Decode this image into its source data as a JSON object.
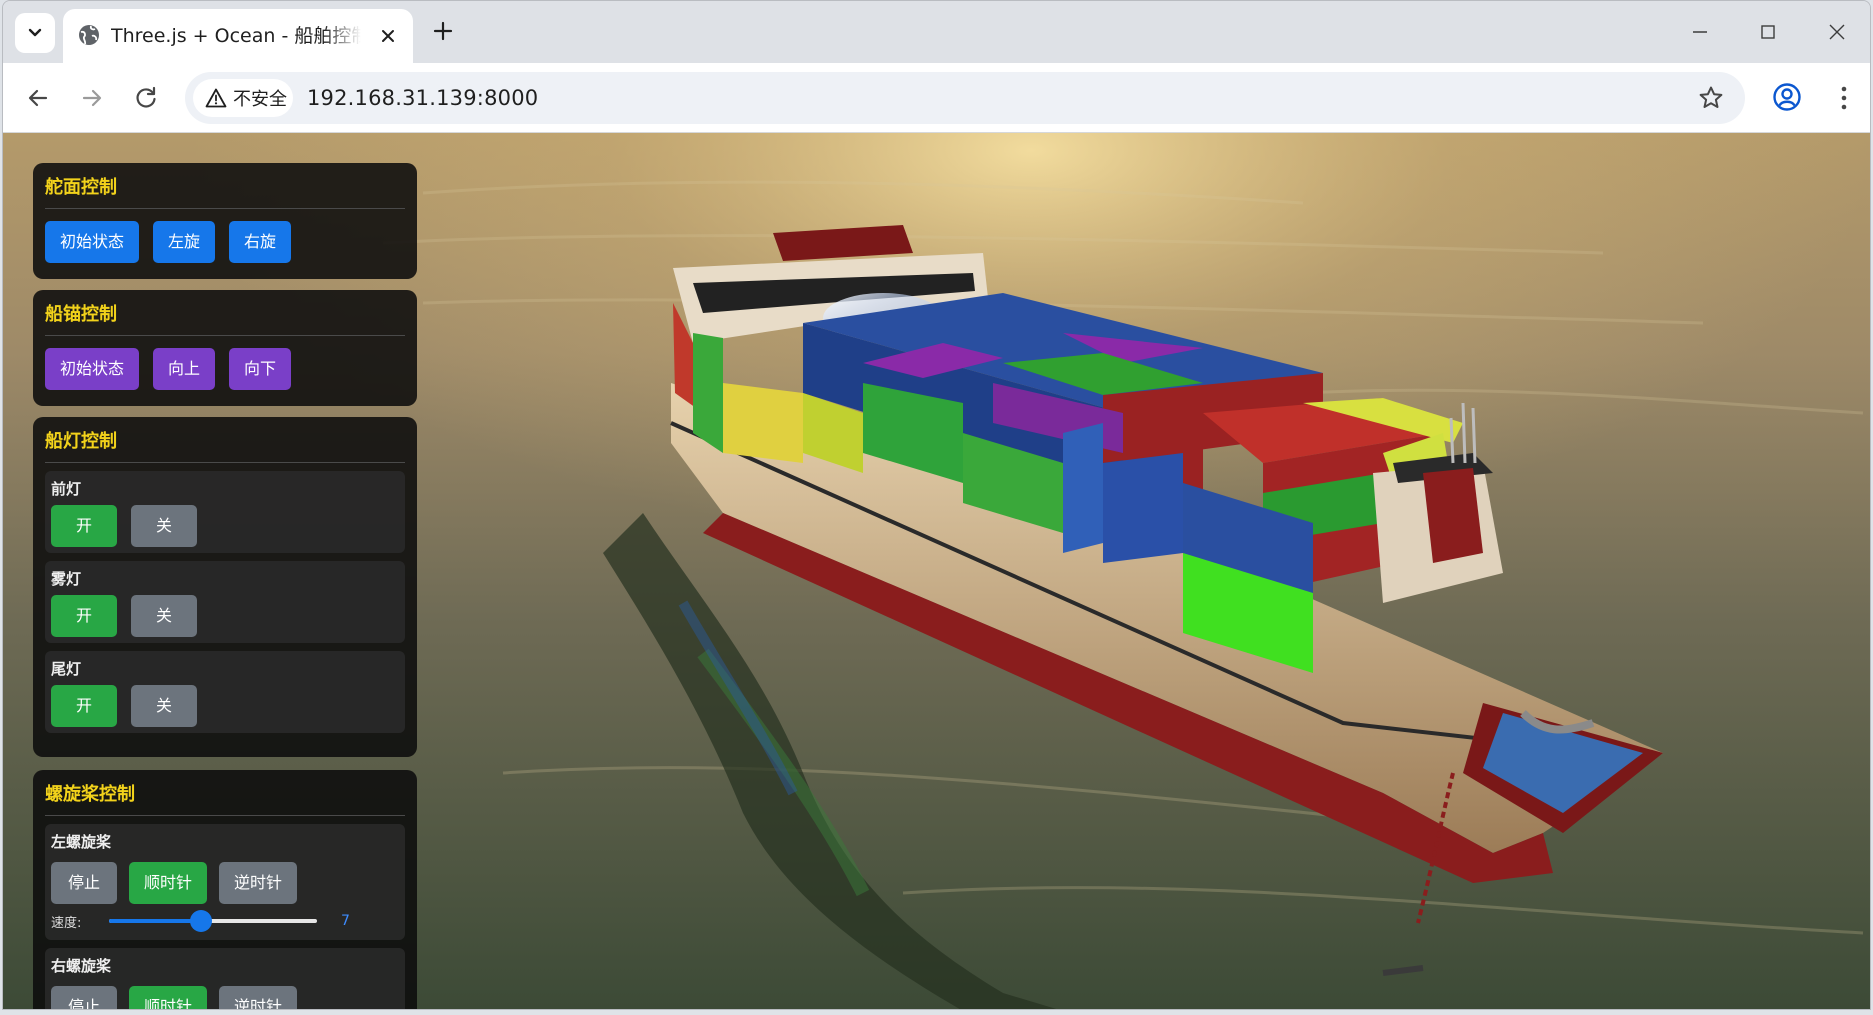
{
  "browser": {
    "tab_title": "Three.js + Ocean - 船舶控制台",
    "security_label": "不安全",
    "url": "192.168.31.139:8000"
  },
  "icons": {
    "tab_search": "chevron-down-icon",
    "favicon": "globe-icon",
    "tab_close": "close-icon",
    "new_tab": "plus-icon",
    "back": "arrow-left-icon",
    "forward": "arrow-right-icon",
    "reload": "reload-icon",
    "security": "warning-icon",
    "bookmark": "star-icon",
    "profile": "profile-icon",
    "menu": "more-vert-icon"
  },
  "rudder": {
    "title": "舵面控制",
    "buttons": [
      "初始状态",
      "左旋",
      "右旋"
    ]
  },
  "anchor": {
    "title": "船锚控制",
    "buttons": [
      "初始状态",
      "向上",
      "向下"
    ]
  },
  "lights": {
    "title": "船灯控制",
    "items": [
      {
        "label": "前灯",
        "on": "开",
        "off": "关"
      },
      {
        "label": "雾灯",
        "on": "开",
        "off": "关"
      },
      {
        "label": "尾灯",
        "on": "开",
        "off": "关"
      }
    ]
  },
  "propeller": {
    "title": "螺旋桨控制",
    "items": [
      {
        "label": "左螺旋桨",
        "stop": "停止",
        "cw": "顺时针",
        "ccw": "逆时针",
        "speed_label": "速度:",
        "speed": "7",
        "speed_fraction": 0.44
      },
      {
        "label": "右螺旋桨",
        "stop": "停止",
        "cw": "顺时针",
        "ccw": "逆时针"
      }
    ]
  },
  "colors": {
    "accent_blue": "#1677ea",
    "accent_purple": "#7a3fc8",
    "on_green": "#28a745",
    "off_gray": "#6c747d",
    "panel_title": "#f2d21b"
  }
}
